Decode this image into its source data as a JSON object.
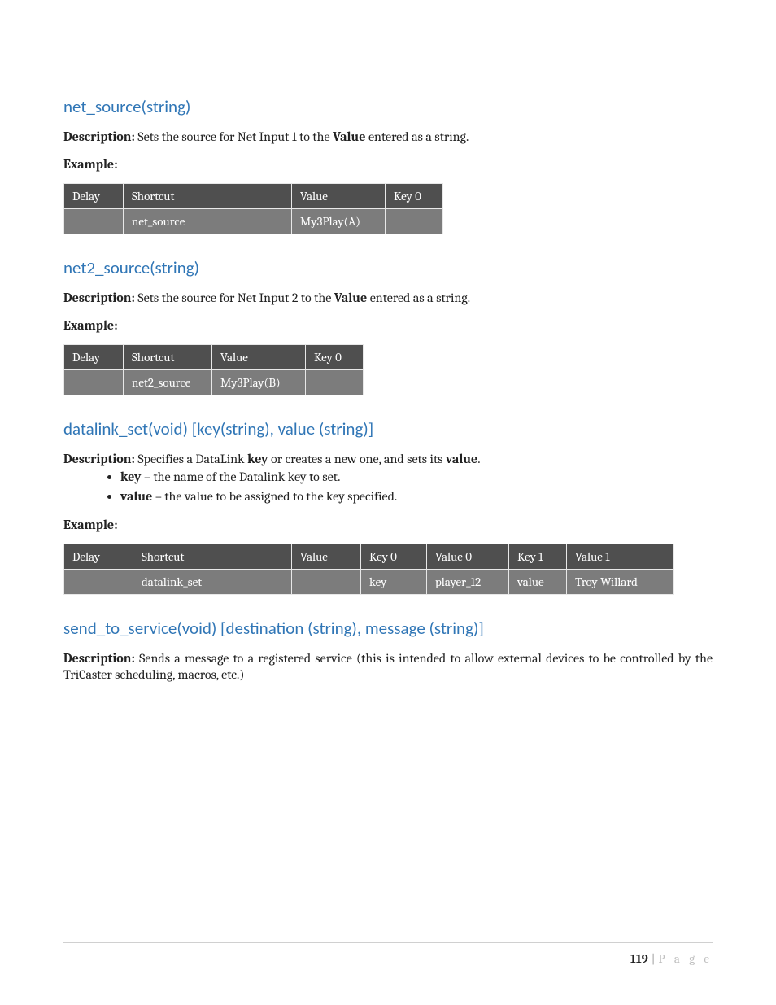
{
  "sections": [
    {
      "heading": "net_source(string)",
      "description": {
        "label": "Description:",
        "before": " Sets the source for Net Input 1 to the ",
        "bold": "Value",
        "after": " entered as a string."
      },
      "example_label": "Example:",
      "table": {
        "headers": [
          "Delay",
          "Shortcut",
          "Value",
          "Key 0"
        ],
        "row": [
          "",
          "net_source",
          "My3Play(A)",
          ""
        ]
      }
    },
    {
      "heading": "net2_source(string)",
      "description": {
        "label": "Description:",
        "before": " Sets the source for Net Input 2 to the ",
        "bold": "Value",
        "after": " entered as a string."
      },
      "example_label": "Example:",
      "table": {
        "headers": [
          "Delay",
          "Shortcut",
          "Value",
          "Key 0"
        ],
        "row": [
          "",
          "net2_source",
          "My3Play(B)",
          ""
        ]
      }
    },
    {
      "heading": "datalink_set(void) [key(string), value (string)]",
      "description": {
        "label": "Description:",
        "before": " Specifies a DataLink ",
        "bold": "key",
        "after": " or creates a new one, and sets its ",
        "bold2": "value",
        "after2": "."
      },
      "bullets": [
        {
          "term": "key",
          "rest": " – the name of the Datalink key to set."
        },
        {
          "term": "value",
          "rest": " – the value to be assigned to the key specified."
        }
      ],
      "example_label": "Example:",
      "table": {
        "headers": [
          "Delay",
          "Shortcut",
          "Value",
          "Key 0",
          "Value 0",
          "Key 1",
          "Value 1"
        ],
        "row": [
          "",
          "datalink_set",
          "",
          "key",
          "player_12",
          "value",
          "Troy Willard"
        ]
      }
    },
    {
      "heading": "send_to_service(void) [destination (string), message (string)]",
      "description_plain": {
        "label": "Description:",
        "text": " Sends a message to a registered service (this is intended to allow external devices to be controlled by the TriCaster scheduling, macros, etc.)"
      }
    }
  ],
  "footer": {
    "page_number": "119",
    "separator": "|",
    "page_word": "P a g e"
  }
}
